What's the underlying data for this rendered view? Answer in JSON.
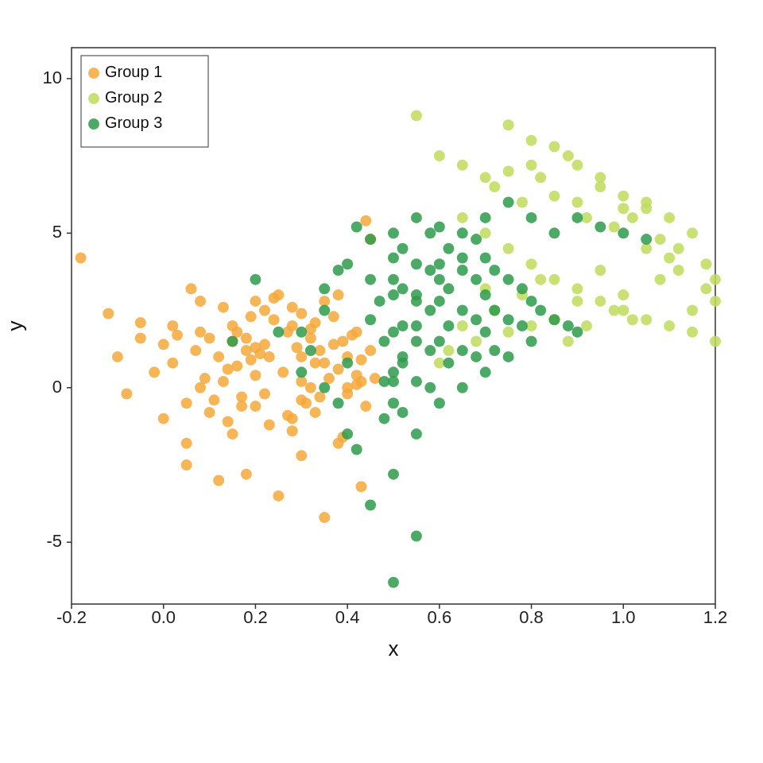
{
  "chart": {
    "title": "",
    "x_label": "x",
    "y_label": "y",
    "x_min": -0.2,
    "x_max": 1.2,
    "y_min": -7,
    "y_max": 11,
    "x_ticks": [
      -0.2,
      0.0,
      0.2,
      0.4,
      0.6,
      0.8,
      1.0,
      1.2
    ],
    "y_ticks": [
      -5,
      0,
      5,
      10
    ],
    "legend": [
      {
        "label": "Group 1",
        "color": "#F4A83A"
      },
      {
        "label": "Group 2",
        "color": "#BFDC5C"
      },
      {
        "label": "Group 3",
        "color": "#2E9B4B"
      }
    ],
    "groups": {
      "group1": {
        "color": "#F4A83A",
        "points": [
          [
            -0.18,
            4.2
          ],
          [
            -0.12,
            2.4
          ],
          [
            -0.05,
            1.6
          ],
          [
            0.0,
            1.4
          ],
          [
            0.02,
            0.8
          ],
          [
            0.05,
            -0.5
          ],
          [
            0.07,
            1.2
          ],
          [
            0.1,
            -0.8
          ],
          [
            0.08,
            2.8
          ],
          [
            0.12,
            1.0
          ],
          [
            0.13,
            0.2
          ],
          [
            0.15,
            -1.5
          ],
          [
            0.14,
            0.6
          ],
          [
            0.16,
            1.8
          ],
          [
            0.18,
            1.6
          ],
          [
            0.2,
            2.8
          ],
          [
            0.18,
            1.2
          ],
          [
            0.2,
            0.4
          ],
          [
            0.22,
            -0.2
          ],
          [
            0.2,
            -0.6
          ],
          [
            0.22,
            1.4
          ],
          [
            0.24,
            2.2
          ],
          [
            0.25,
            3.0
          ],
          [
            0.27,
            1.8
          ],
          [
            0.28,
            2.6
          ],
          [
            0.3,
            1.0
          ],
          [
            0.3,
            0.2
          ],
          [
            0.3,
            -0.4
          ],
          [
            0.28,
            -1.0
          ],
          [
            0.3,
            2.4
          ],
          [
            0.32,
            1.6
          ],
          [
            0.32,
            0.0
          ],
          [
            0.33,
            -0.8
          ],
          [
            0.34,
            1.2
          ],
          [
            0.35,
            2.8
          ],
          [
            0.35,
            0.8
          ],
          [
            0.37,
            1.4
          ],
          [
            0.38,
            3.0
          ],
          [
            0.38,
            0.6
          ],
          [
            0.4,
            1.0
          ],
          [
            0.4,
            0.0
          ],
          [
            0.4,
            -0.2
          ],
          [
            0.42,
            1.8
          ],
          [
            0.42,
            0.4
          ],
          [
            0.44,
            5.4
          ],
          [
            0.45,
            4.8
          ],
          [
            0.43,
            0.2
          ],
          [
            0.44,
            -0.6
          ],
          [
            0.05,
            -1.8
          ],
          [
            0.08,
            0.0
          ],
          [
            0.1,
            1.6
          ],
          [
            0.15,
            2.0
          ],
          [
            0.17,
            -0.3
          ],
          [
            0.19,
            0.9
          ],
          [
            0.21,
            1.1
          ],
          [
            0.23,
            -1.2
          ],
          [
            0.26,
            0.5
          ],
          [
            0.29,
            1.3
          ],
          [
            0.31,
            -0.5
          ],
          [
            0.33,
            2.1
          ],
          [
            0.36,
            0.3
          ],
          [
            0.39,
            -1.6
          ],
          [
            0.41,
            1.7
          ],
          [
            0.43,
            -3.2
          ],
          [
            0.0,
            -1.0
          ],
          [
            0.05,
            -2.5
          ],
          [
            0.12,
            -3.0
          ],
          [
            0.18,
            -2.8
          ],
          [
            0.25,
            -3.5
          ],
          [
            0.3,
            -2.2
          ],
          [
            0.35,
            -4.2
          ],
          [
            0.38,
            -1.8
          ],
          [
            0.15,
            1.5
          ],
          [
            0.22,
            2.5
          ],
          [
            0.27,
            -0.9
          ],
          [
            0.32,
            1.9
          ],
          [
            0.02,
            2.0
          ],
          [
            0.06,
            3.2
          ],
          [
            0.11,
            -0.4
          ],
          [
            0.16,
            0.7
          ],
          [
            0.2,
            1.3
          ],
          [
            0.24,
            2.9
          ],
          [
            0.28,
            -1.4
          ],
          [
            0.33,
            0.8
          ],
          [
            0.37,
            2.3
          ],
          [
            0.42,
            0.1
          ],
          [
            0.45,
            1.2
          ],
          [
            0.08,
            1.8
          ],
          [
            0.13,
            2.6
          ],
          [
            0.17,
            -0.6
          ],
          [
            0.23,
            1.0
          ],
          [
            0.28,
            2.0
          ],
          [
            0.34,
            -0.3
          ],
          [
            0.39,
            1.5
          ],
          [
            0.43,
            0.9
          ],
          [
            0.46,
            0.3
          ],
          [
            -0.1,
            1.0
          ],
          [
            -0.08,
            -0.2
          ],
          [
            -0.05,
            2.1
          ],
          [
            -0.02,
            0.5
          ],
          [
            0.03,
            1.7
          ],
          [
            0.09,
            0.3
          ],
          [
            0.14,
            -1.1
          ],
          [
            0.19,
            2.3
          ]
        ]
      },
      "group2": {
        "color": "#BFDC5C",
        "points": [
          [
            0.55,
            8.8
          ],
          [
            0.6,
            7.5
          ],
          [
            0.65,
            7.2
          ],
          [
            0.7,
            6.8
          ],
          [
            0.72,
            6.5
          ],
          [
            0.75,
            7.0
          ],
          [
            0.78,
            6.0
          ],
          [
            0.8,
            7.2
          ],
          [
            0.82,
            6.8
          ],
          [
            0.85,
            6.2
          ],
          [
            0.88,
            7.5
          ],
          [
            0.9,
            6.0
          ],
          [
            0.92,
            5.5
          ],
          [
            0.95,
            6.8
          ],
          [
            0.98,
            5.2
          ],
          [
            1.0,
            5.8
          ],
          [
            1.02,
            5.5
          ],
          [
            1.05,
            6.0
          ],
          [
            1.08,
            4.8
          ],
          [
            1.1,
            5.5
          ],
          [
            1.12,
            4.5
          ],
          [
            1.15,
            5.0
          ],
          [
            1.18,
            4.0
          ],
          [
            1.2,
            3.5
          ],
          [
            1.2,
            2.8
          ],
          [
            1.18,
            3.2
          ],
          [
            1.15,
            2.5
          ],
          [
            1.12,
            3.8
          ],
          [
            1.1,
            4.2
          ],
          [
            1.08,
            3.5
          ],
          [
            1.05,
            4.5
          ],
          [
            1.02,
            2.2
          ],
          [
            1.0,
            3.0
          ],
          [
            0.98,
            2.5
          ],
          [
            0.95,
            3.8
          ],
          [
            0.92,
            2.0
          ],
          [
            0.9,
            2.8
          ],
          [
            0.88,
            1.5
          ],
          [
            0.85,
            2.2
          ],
          [
            0.82,
            3.5
          ],
          [
            0.8,
            2.0
          ],
          [
            0.78,
            3.0
          ],
          [
            0.75,
            1.8
          ],
          [
            0.72,
            2.5
          ],
          [
            0.7,
            3.2
          ],
          [
            0.68,
            1.5
          ],
          [
            0.65,
            2.0
          ],
          [
            0.62,
            1.2
          ],
          [
            0.6,
            0.8
          ],
          [
            0.75,
            8.5
          ],
          [
            0.8,
            8.0
          ],
          [
            0.85,
            7.8
          ],
          [
            0.9,
            7.2
          ],
          [
            0.95,
            6.5
          ],
          [
            1.0,
            6.2
          ],
          [
            1.05,
            5.8
          ],
          [
            0.65,
            5.5
          ],
          [
            0.7,
            5.0
          ],
          [
            0.75,
            4.5
          ],
          [
            0.8,
            4.0
          ],
          [
            0.85,
            3.5
          ],
          [
            0.9,
            3.2
          ],
          [
            0.95,
            2.8
          ],
          [
            1.0,
            2.5
          ],
          [
            1.05,
            2.2
          ],
          [
            1.1,
            2.0
          ],
          [
            1.15,
            1.8
          ],
          [
            1.2,
            1.5
          ]
        ]
      },
      "group3": {
        "color": "#2E9B4B",
        "points": [
          [
            0.15,
            1.5
          ],
          [
            0.2,
            3.5
          ],
          [
            0.25,
            1.8
          ],
          [
            0.3,
            0.5
          ],
          [
            0.32,
            1.2
          ],
          [
            0.35,
            2.5
          ],
          [
            0.38,
            3.8
          ],
          [
            0.4,
            0.8
          ],
          [
            0.42,
            5.2
          ],
          [
            0.45,
            4.8
          ],
          [
            0.45,
            3.5
          ],
          [
            0.47,
            2.8
          ],
          [
            0.48,
            1.5
          ],
          [
            0.48,
            0.2
          ],
          [
            0.5,
            5.0
          ],
          [
            0.5,
            4.2
          ],
          [
            0.5,
            3.0
          ],
          [
            0.5,
            1.8
          ],
          [
            0.5,
            0.5
          ],
          [
            0.5,
            -0.5
          ],
          [
            0.5,
            -2.8
          ],
          [
            0.5,
            -6.3
          ],
          [
            0.52,
            4.5
          ],
          [
            0.52,
            3.2
          ],
          [
            0.52,
            2.0
          ],
          [
            0.52,
            0.8
          ],
          [
            0.52,
            -0.8
          ],
          [
            0.55,
            5.5
          ],
          [
            0.55,
            4.0
          ],
          [
            0.55,
            2.8
          ],
          [
            0.55,
            1.5
          ],
          [
            0.55,
            0.2
          ],
          [
            0.55,
            -1.5
          ],
          [
            0.55,
            -4.8
          ],
          [
            0.58,
            5.0
          ],
          [
            0.58,
            3.8
          ],
          [
            0.58,
            2.5
          ],
          [
            0.58,
            1.2
          ],
          [
            0.58,
            0.0
          ],
          [
            0.6,
            5.2
          ],
          [
            0.6,
            4.0
          ],
          [
            0.6,
            2.8
          ],
          [
            0.6,
            1.5
          ],
          [
            0.6,
            -0.5
          ],
          [
            0.62,
            4.5
          ],
          [
            0.62,
            3.2
          ],
          [
            0.62,
            2.0
          ],
          [
            0.62,
            0.8
          ],
          [
            0.65,
            5.0
          ],
          [
            0.65,
            3.8
          ],
          [
            0.65,
            2.5
          ],
          [
            0.65,
            1.2
          ],
          [
            0.65,
            0.0
          ],
          [
            0.68,
            4.8
          ],
          [
            0.68,
            3.5
          ],
          [
            0.68,
            2.2
          ],
          [
            0.68,
            1.0
          ],
          [
            0.7,
            4.2
          ],
          [
            0.7,
            3.0
          ],
          [
            0.7,
            1.8
          ],
          [
            0.7,
            0.5
          ],
          [
            0.72,
            3.8
          ],
          [
            0.72,
            2.5
          ],
          [
            0.72,
            1.2
          ],
          [
            0.75,
            3.5
          ],
          [
            0.75,
            2.2
          ],
          [
            0.75,
            1.0
          ],
          [
            0.78,
            3.2
          ],
          [
            0.78,
            2.0
          ],
          [
            0.8,
            2.8
          ],
          [
            0.8,
            1.5
          ],
          [
            0.82,
            2.5
          ],
          [
            0.85,
            2.2
          ],
          [
            0.88,
            2.0
          ],
          [
            0.9,
            1.8
          ],
          [
            0.35,
            0.0
          ],
          [
            0.38,
            -0.5
          ],
          [
            0.4,
            -1.5
          ],
          [
            0.42,
            -2.0
          ],
          [
            0.45,
            -3.8
          ],
          [
            0.48,
            -1.0
          ],
          [
            0.5,
            0.2
          ],
          [
            0.52,
            1.0
          ],
          [
            0.55,
            2.0
          ],
          [
            0.3,
            1.8
          ],
          [
            0.35,
            3.2
          ],
          [
            0.4,
            4.0
          ],
          [
            0.45,
            2.2
          ],
          [
            0.5,
            3.5
          ],
          [
            0.55,
            3.0
          ],
          [
            0.6,
            3.5
          ],
          [
            0.65,
            4.2
          ],
          [
            0.7,
            5.5
          ],
          [
            0.75,
            6.0
          ],
          [
            0.8,
            5.5
          ],
          [
            0.85,
            5.0
          ],
          [
            0.9,
            5.5
          ],
          [
            0.95,
            5.2
          ],
          [
            1.0,
            5.0
          ],
          [
            1.05,
            4.8
          ]
        ]
      }
    }
  }
}
